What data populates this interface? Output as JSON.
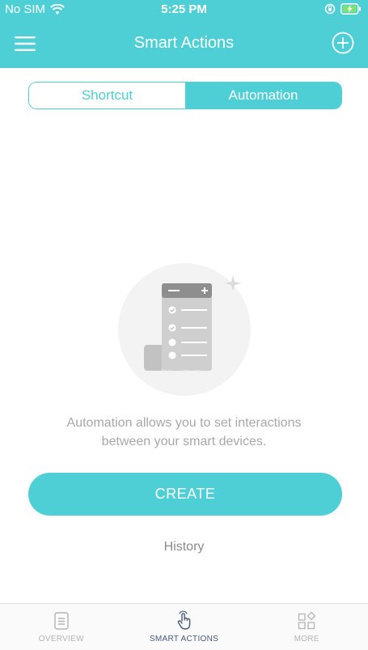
{
  "status_bar": {
    "carrier": "No SIM",
    "time": "5:25 PM"
  },
  "navbar": {
    "title": "Smart Actions",
    "menu_icon": "hamburger-icon",
    "add_icon": "plus-circle-icon"
  },
  "segment": {
    "tabs": [
      {
        "label": "Shortcut",
        "selected": false
      },
      {
        "label": "Automation",
        "selected": true
      }
    ]
  },
  "empty_state": {
    "icon": "checklist-scroll-icon",
    "message_line1": "Automation allows you to set interactions",
    "message_line2": "between your smart devices."
  },
  "actions": {
    "create_label": "CREATE",
    "history_label": "History"
  },
  "tabbar": {
    "items": [
      {
        "label": "OVERVIEW",
        "icon": "document-list-icon",
        "active": false
      },
      {
        "label": "SMART ACTIONS",
        "icon": "hand-tap-icon",
        "active": true
      },
      {
        "label": "MORE",
        "icon": "grid-diamond-icon",
        "active": false
      }
    ]
  },
  "colors": {
    "accent": "#4ecfd6",
    "tab_active": "#4a5a78",
    "tab_inactive": "#b4b4b4",
    "muted_text": "#a8a8a8"
  }
}
